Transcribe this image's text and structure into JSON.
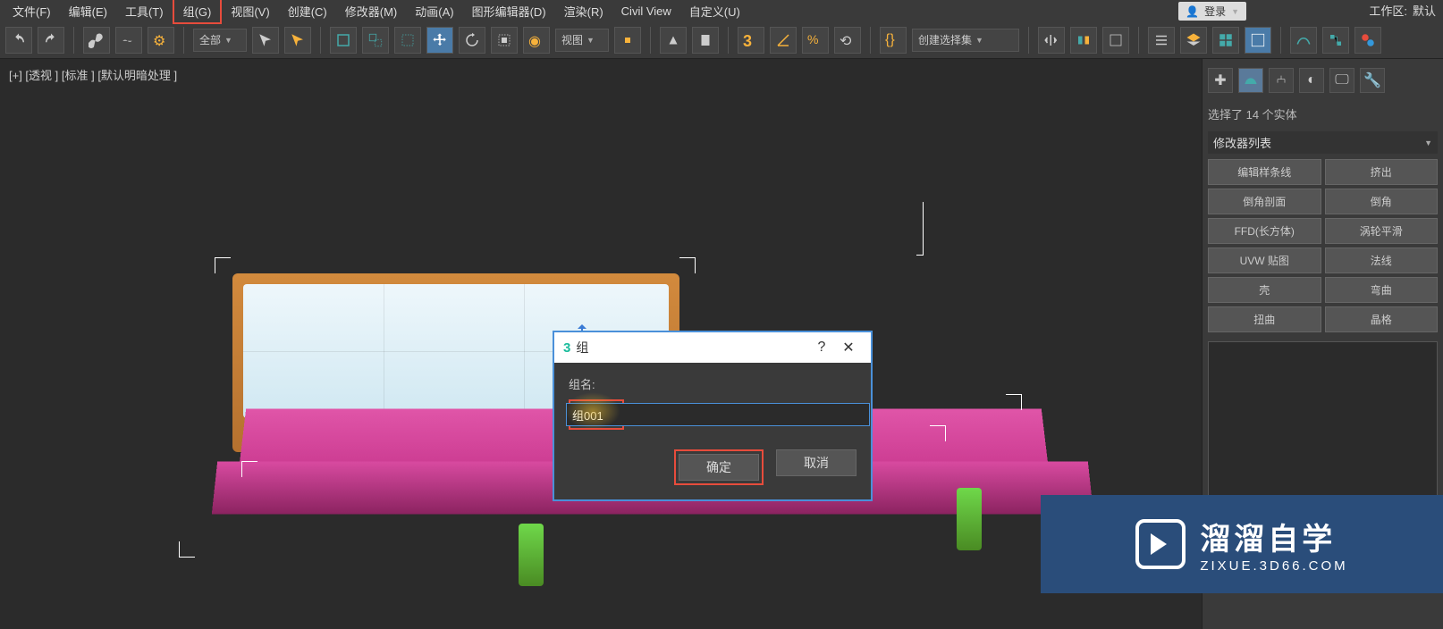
{
  "menu": {
    "file": "文件(F)",
    "edit": "编辑(E)",
    "tools": "工具(T)",
    "group": "组(G)",
    "view": "视图(V)",
    "create": "创建(C)",
    "modifiers": "修改器(M)",
    "animation": "动画(A)",
    "graph_editors": "图形编辑器(D)",
    "rendering": "渲染(R)",
    "civil_view": "Civil View",
    "customize": "自定义(U)"
  },
  "login": {
    "label": "登录"
  },
  "workspace": {
    "label": "工作区:",
    "value": "默认"
  },
  "toolbar": {
    "filter_all": "全部",
    "view_dropdown": "视图",
    "selection_set": "创建选择集"
  },
  "viewport": {
    "labels": "[+] [透视 ] [标准 ] [默认明暗处理 ]"
  },
  "right_panel": {
    "selection_info": "选择了 14 个实体",
    "modifier_list_label": "修改器列表",
    "buttons": {
      "edit_spline": "编辑样条线",
      "extrude": "挤出",
      "chamfer_profile": "倒角剖面",
      "chamfer": "倒角",
      "ffd_box": "FFD(长方体)",
      "turbosmooth": "涡轮平滑",
      "uvw_map": "UVW 贴图",
      "normal": "法线",
      "shell": "壳",
      "bend": "弯曲",
      "twist": "扭曲",
      "lattice": "晶格"
    }
  },
  "dialog": {
    "title": "组",
    "group_name_label": "组名:",
    "group_name_value": "组001",
    "ok": "确定",
    "cancel": "取消"
  },
  "watermark": {
    "cn": "溜溜自学",
    "en": "ZIXUE.3D66.COM"
  }
}
